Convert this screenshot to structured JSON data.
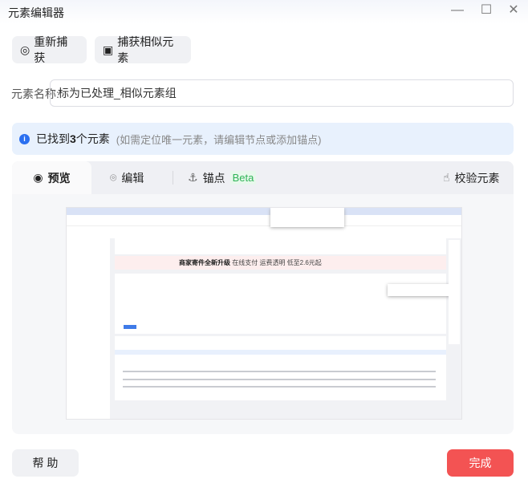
{
  "window": {
    "title": "元素编辑器"
  },
  "toolbar": {
    "recapture": "重新捕获",
    "capture_similar": "捕获相似元素"
  },
  "name_field": {
    "label": "元素名称:",
    "value": "标为已处理_相似元素组"
  },
  "info": {
    "prefix": "已找到",
    "count": "3",
    "suffix": "个元素",
    "hint": "(如需定位唯一元素，请编辑节点或添加锚点)"
  },
  "tabs": [
    {
      "label": "预览"
    },
    {
      "label": "编辑"
    },
    {
      "label": "锚点",
      "badge": "Beta"
    }
  ],
  "verify": "校验元素",
  "preview": {
    "banner_title": "商家寄件全新升级",
    "banner_text": "在线支付  运费透明  低至2.6元起"
  },
  "footer": {
    "help": "帮 助",
    "done": "完成"
  },
  "colors": {
    "accent": "#2a6ff0",
    "done": "#f35353"
  }
}
